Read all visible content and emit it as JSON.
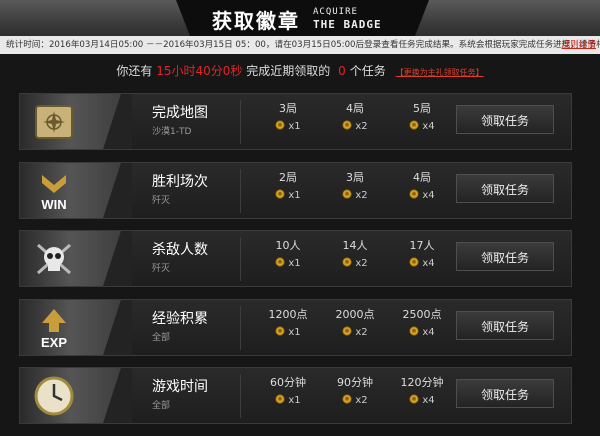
{
  "header": {
    "title_cn": "获取徽章",
    "title_en_line1": "ACQUIRE",
    "title_en_line2": "THE BADGE"
  },
  "notice": {
    "text": "统计时间：2016年03月14日05:00 －－2016年03月15日 05：00，请在03月15日05:00后登录查看任务完成结果。系统会根据玩家完成任务进度，给予相应的徽章奖励。",
    "rules_link": "规则详情"
  },
  "countdown": {
    "prefix": "你还有",
    "time": "15小时40分0秒",
    "middle": "完成近期领取的",
    "count": "0",
    "suffix": "个任务",
    "change_link": "【更换为主礼领取任务】"
  },
  "tasks": [
    {
      "name": "完成地图",
      "sub": "沙漠1-TD",
      "icon": "map-badge-icon",
      "tiers": [
        {
          "req": "3局",
          "reward": "x1"
        },
        {
          "req": "4局",
          "reward": "x2"
        },
        {
          "req": "5局",
          "reward": "x4"
        }
      ],
      "button": "领取任务"
    },
    {
      "name": "胜利场次",
      "sub": "歼灭",
      "icon": "win-badge-icon",
      "tiers": [
        {
          "req": "2局",
          "reward": "x1"
        },
        {
          "req": "3局",
          "reward": "x2"
        },
        {
          "req": "4局",
          "reward": "x4"
        }
      ],
      "button": "领取任务"
    },
    {
      "name": "杀敌人数",
      "sub": "歼灭",
      "icon": "skull-badge-icon",
      "tiers": [
        {
          "req": "10人",
          "reward": "x1"
        },
        {
          "req": "14人",
          "reward": "x2"
        },
        {
          "req": "17人",
          "reward": "x4"
        }
      ],
      "button": "领取任务"
    },
    {
      "name": "经验积累",
      "sub": "全部",
      "icon": "exp-badge-icon",
      "tiers": [
        {
          "req": "1200点",
          "reward": "x1"
        },
        {
          "req": "2000点",
          "reward": "x2"
        },
        {
          "req": "2500点",
          "reward": "x4"
        }
      ],
      "button": "领取任务"
    },
    {
      "name": "游戏时间",
      "sub": "全部",
      "icon": "clock-badge-icon",
      "tiers": [
        {
          "req": "60分钟",
          "reward": "x1"
        },
        {
          "req": "90分钟",
          "reward": "x2"
        },
        {
          "req": "120分钟",
          "reward": "x4"
        }
      ],
      "button": "领取任务"
    }
  ],
  "colors": {
    "accent_red": "#e0242a",
    "coin_gold": "#d9a521",
    "background": "#161616"
  }
}
